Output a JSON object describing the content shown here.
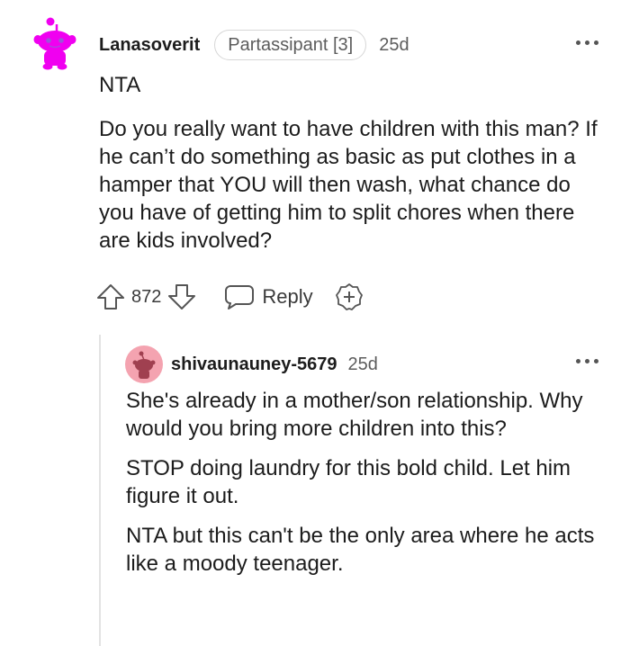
{
  "comment": {
    "username": "Lanasoverit",
    "flair": "Partassipant [3]",
    "timestamp": "25d",
    "paragraphs": [
      "NTA",
      "Do you really want to have children with this man? If he can’t do something as basic as put clothes in a hamper that YOU will then wash, what chance do you have of getting him to split chores when there are kids involved?"
    ],
    "vote_count": "872",
    "reply_label": "Reply",
    "avatar_icon": "snoo-avatar-magenta-icon"
  },
  "reply": {
    "username": "shivaunauney-5679",
    "timestamp": "25d",
    "paragraphs": [
      "She's already in a mother/son relationship. Why would you bring more children into this?",
      "STOP doing laundry for this bold child. Let him figure it out.",
      "NTA but this can't be the only area where he acts like a moody teenager."
    ],
    "avatar_icon": "default-avatar-pink-icon"
  },
  "colors": {
    "avatar_main": "#f000f0",
    "avatar_reply_bg": "#f4a3b0",
    "icon_gray": "#555555",
    "thread_line": "#e3e3e3"
  }
}
